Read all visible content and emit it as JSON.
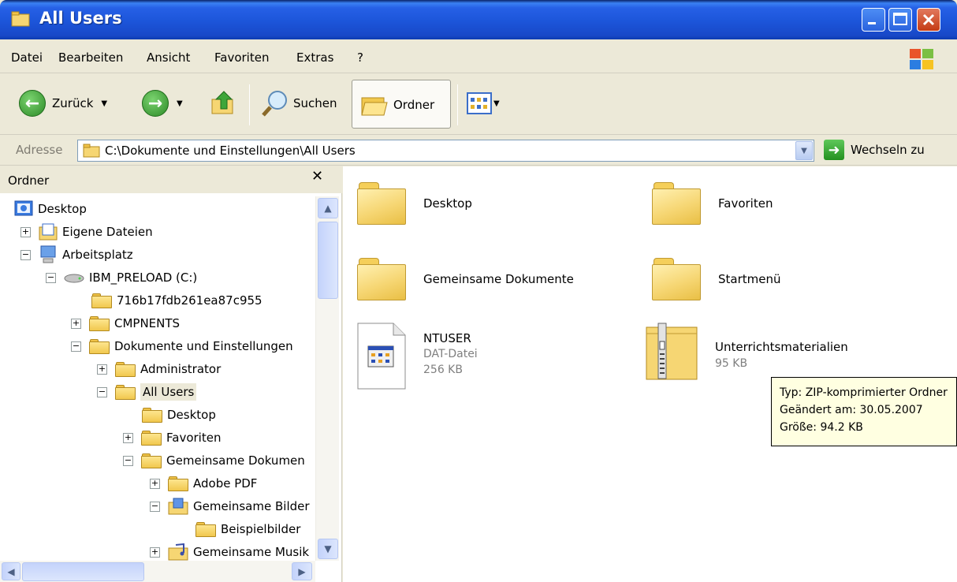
{
  "window": {
    "title": "All Users"
  },
  "menu": [
    "Datei",
    "Bearbeiten",
    "Ansicht",
    "Favoriten",
    "Extras",
    "?"
  ],
  "toolbar": {
    "back_label": "Zurück",
    "search_label": "Suchen",
    "folders_label": "Ordner"
  },
  "address": {
    "label": "Adresse",
    "value": "C:\\Dokumente und Einstellungen\\All Users",
    "go_label": "Wechseln zu"
  },
  "folder_pane": {
    "title": "Ordner",
    "tree": [
      {
        "label": "Desktop",
        "expander": ""
      },
      {
        "label": "Eigene Dateien",
        "expander": "+"
      },
      {
        "label": "Arbeitsplatz",
        "expander": "−"
      },
      {
        "label": "IBM_PRELOAD (C:)",
        "expander": "−"
      },
      {
        "label": "716b17fdb261ea87c955",
        "expander": ""
      },
      {
        "label": "CMPNENTS",
        "expander": "+"
      },
      {
        "label": "Dokumente und Einstellungen",
        "expander": "−"
      },
      {
        "label": "Administrator",
        "expander": "+"
      },
      {
        "label": "All Users",
        "expander": "−",
        "selected": true
      },
      {
        "label": "Desktop",
        "expander": ""
      },
      {
        "label": "Favoriten",
        "expander": "+"
      },
      {
        "label": "Gemeinsame Dokumen",
        "expander": "−"
      },
      {
        "label": "Adobe PDF",
        "expander": "+"
      },
      {
        "label": "Gemeinsame Bilder",
        "expander": "−"
      },
      {
        "label": "Beispielbilder",
        "expander": ""
      },
      {
        "label": "Gemeinsame Musik",
        "expander": "+"
      }
    ]
  },
  "content": {
    "items": [
      {
        "name": "Desktop",
        "type": "folder"
      },
      {
        "name": "Favoriten",
        "type": "folder"
      },
      {
        "name": "Gemeinsame Dokumente",
        "type": "folder"
      },
      {
        "name": "Startmenü",
        "type": "folder"
      },
      {
        "name": "NTUSER",
        "type": "file",
        "kind": "DAT-Datei",
        "size": "256 KB"
      },
      {
        "name": "Unterrichtsmaterialien",
        "type": "zip",
        "size": "95 KB"
      }
    ]
  },
  "tooltip": {
    "line1": "Typ: ZIP-komprimierter Ordner",
    "line2": "Geändert am: 30.05.2007",
    "line3": "Größe: 94.2 KB"
  },
  "colors": {
    "titlebar": "#2660e6",
    "chrome": "#ece9d8",
    "folder": "#f6d673",
    "tooltip_bg": "#ffffe1"
  }
}
